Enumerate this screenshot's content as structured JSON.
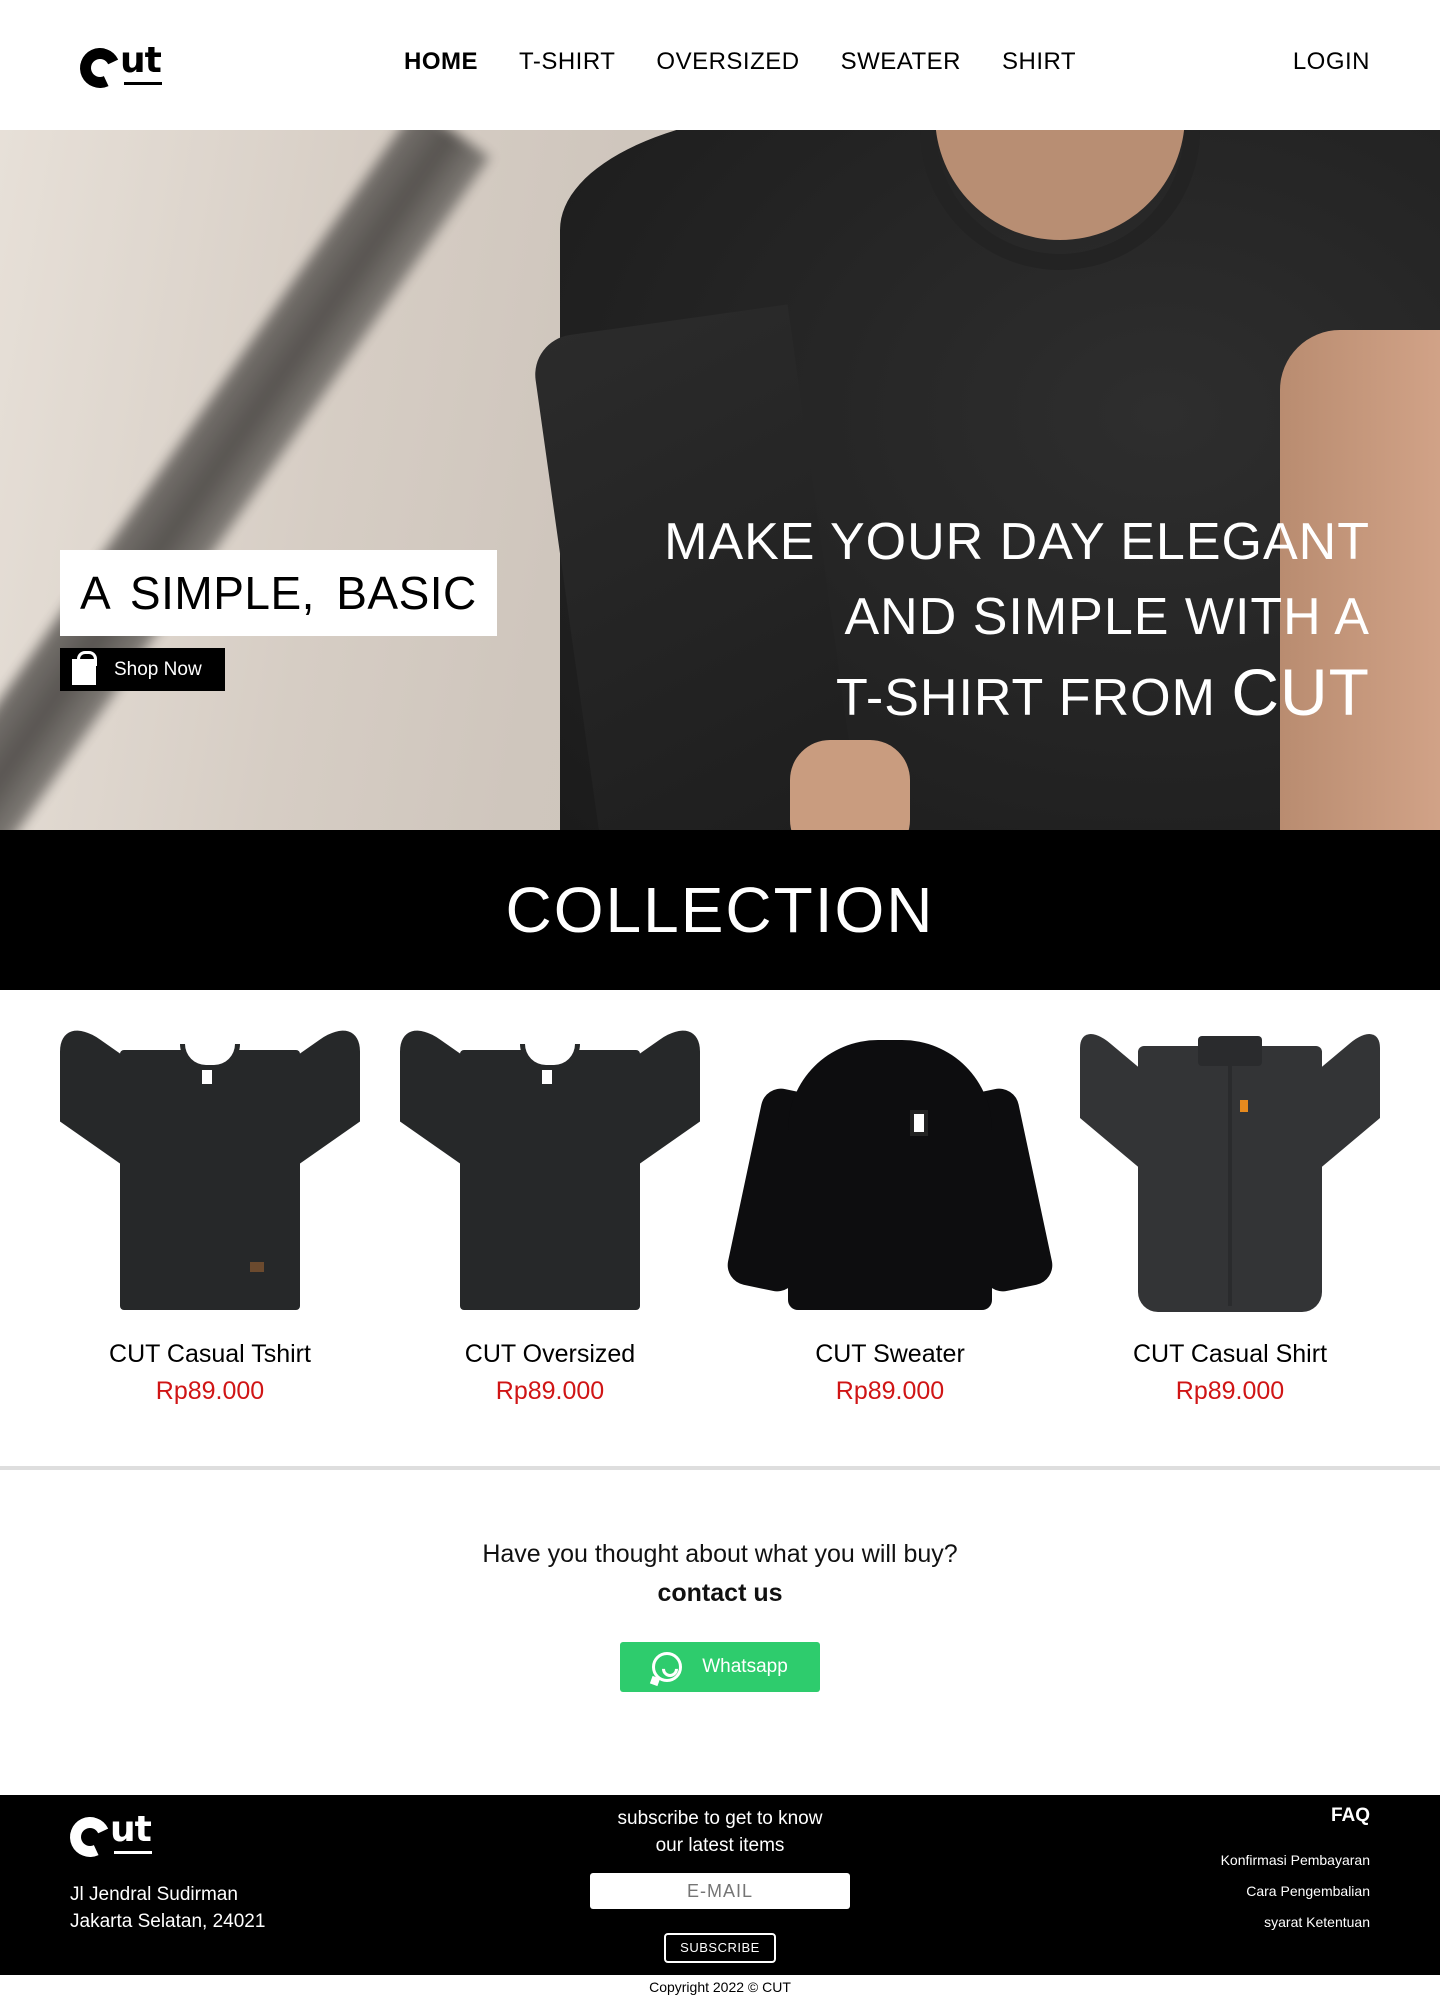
{
  "header": {
    "logo_text": "ut",
    "nav": [
      "HOME",
      "T-SHIRT",
      "OVERSIZED",
      "SWEATER",
      "SHIRT"
    ],
    "login": "LOGIN"
  },
  "hero": {
    "tagline": "A  SIMPLE, BASIC",
    "shop_button": "Shop Now",
    "headline_1": "MAKE YOUR DAY ELEGANT",
    "headline_2": "AND SIMPLE WITH A",
    "headline_3": "T-SHIRT FROM",
    "headline_brand": "CUT"
  },
  "collection": {
    "title": "COLLECTION"
  },
  "products": [
    {
      "name": "CUT Casual Tshirt",
      "price": "Rp89.000"
    },
    {
      "name": "CUT Oversized",
      "price": "Rp89.000"
    },
    {
      "name": "CUT Sweater",
      "price": "Rp89.000"
    },
    {
      "name": "CUT Casual Shirt",
      "price": "Rp89.000"
    }
  ],
  "contact": {
    "question": "Have you thought about what you will buy?",
    "cta": "contact us",
    "whatsapp": "Whatsapp"
  },
  "footer": {
    "logo_text": "ut",
    "address_1": "Jl Jendral Sudirman",
    "address_2": "Jakarta Selatan, 24021",
    "subscribe_1": "subscribe to get to know",
    "subscribe_2": "our latest items",
    "email_placeholder": "E-MAIL",
    "subscribe_button": "SUBSCRIBE",
    "faq_title": "FAQ",
    "faq_items": [
      "Konfirmasi Pembayaran",
      "Cara Pengembalian",
      "syarat Ketentuan"
    ]
  },
  "copyright": "Copyright 2022 © CUT",
  "colors": {
    "price": "#d01515",
    "whatsapp": "#2ecc6d",
    "band": "#000000"
  },
  "icons": {
    "shop": "shopping-bag-icon",
    "whatsapp": "whatsapp-icon"
  }
}
